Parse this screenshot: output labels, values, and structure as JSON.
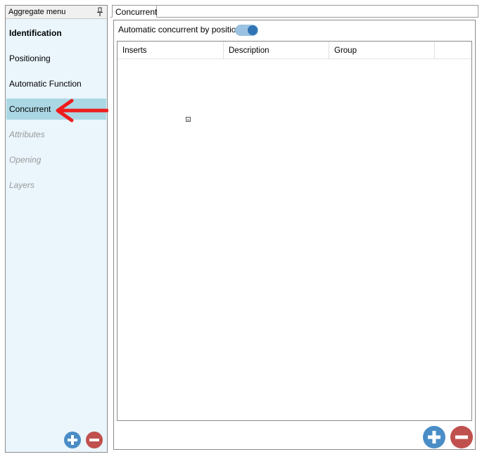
{
  "left_panel": {
    "title": "Aggregate menu",
    "pin_icon": "pin-icon",
    "items": [
      {
        "label": "Identification",
        "state": "bold"
      },
      {
        "label": "Positioning",
        "state": "normal"
      },
      {
        "label": "Automatic Function",
        "state": "normal"
      },
      {
        "label": "Concurrent",
        "state": "selected"
      },
      {
        "label": "Attributes",
        "state": "disabled"
      },
      {
        "label": "Opening",
        "state": "disabled"
      },
      {
        "label": "Layers",
        "state": "disabled"
      }
    ],
    "add_icon": "plus-circle-icon",
    "remove_icon": "minus-circle-icon"
  },
  "tabs": [
    {
      "label": "Concurrent",
      "active": true
    }
  ],
  "concurrent": {
    "toggle_label": "Automatic concurrent by position",
    "toggle_on": true,
    "columns": [
      "Inserts",
      "Description",
      "Group"
    ],
    "rows": [],
    "add_icon": "plus-circle-icon",
    "remove_icon": "minus-circle-icon"
  },
  "annotation": {
    "arrow_icon": "red-arrow-icon",
    "arrow_color": "#ee1c1c"
  },
  "colors": {
    "selected_bg": "#abd7e4",
    "panel_bg": "#eaf5fc",
    "add_blue": "#4a8dc6",
    "remove_red": "#c0504d",
    "toggle_knob": "#2f74b5"
  }
}
